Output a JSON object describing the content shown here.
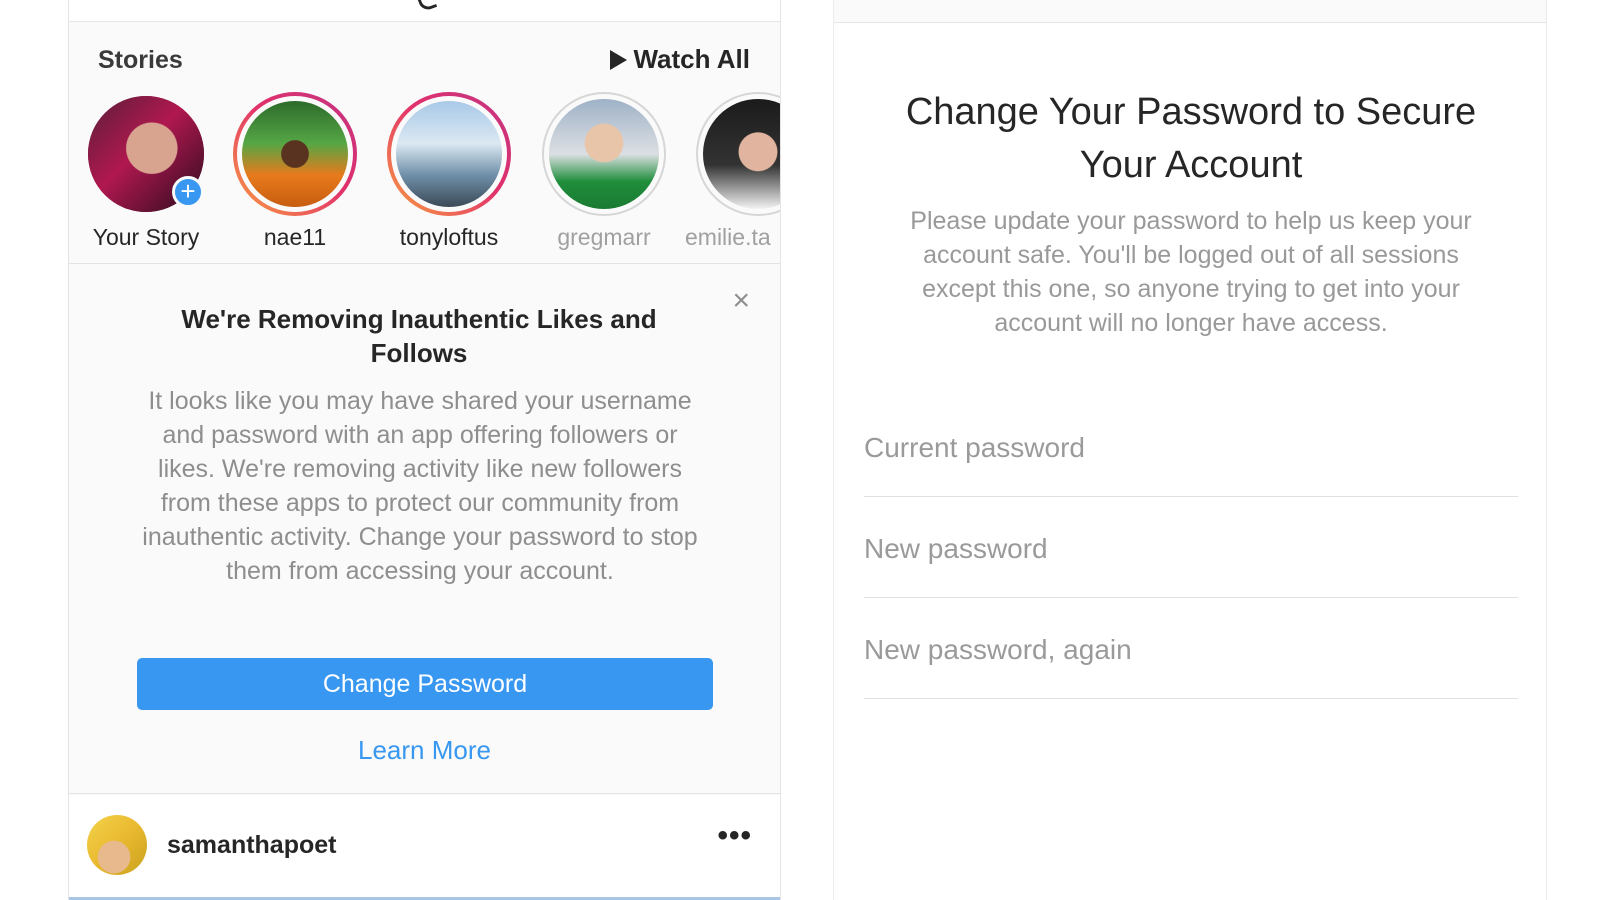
{
  "stories": {
    "title": "Stories",
    "watch_all": "Watch All",
    "items": [
      {
        "label": "Your Story"
      },
      {
        "label": "nae11"
      },
      {
        "label": "tonyloftus"
      },
      {
        "label": "gregmarr"
      },
      {
        "label": "emilie.ta"
      }
    ]
  },
  "notice": {
    "title": "We're Removing Inauthentic Likes and Follows",
    "body": "It looks like you may have shared your username and password with an app offering followers or likes. We're removing activity like new followers from these apps to protect our community from inauthentic activity. Change your password to stop them from accessing your account.",
    "button": "Change Password",
    "link": "Learn More",
    "close": "×"
  },
  "post": {
    "username": "samanthapoet",
    "more": "•••"
  },
  "change_password": {
    "heading": "Change Your Password to Secure Your Account",
    "subtext": "Please update your password to help us keep your account safe. You'll be logged out of all sessions except this one, so anyone trying to get into your account will no longer have access.",
    "fields": [
      {
        "placeholder": "Current password"
      },
      {
        "placeholder": "New password"
      },
      {
        "placeholder": "New password, again"
      }
    ]
  },
  "colors": {
    "accent": "#3897f0",
    "muted_text": "#8e8e8e"
  }
}
